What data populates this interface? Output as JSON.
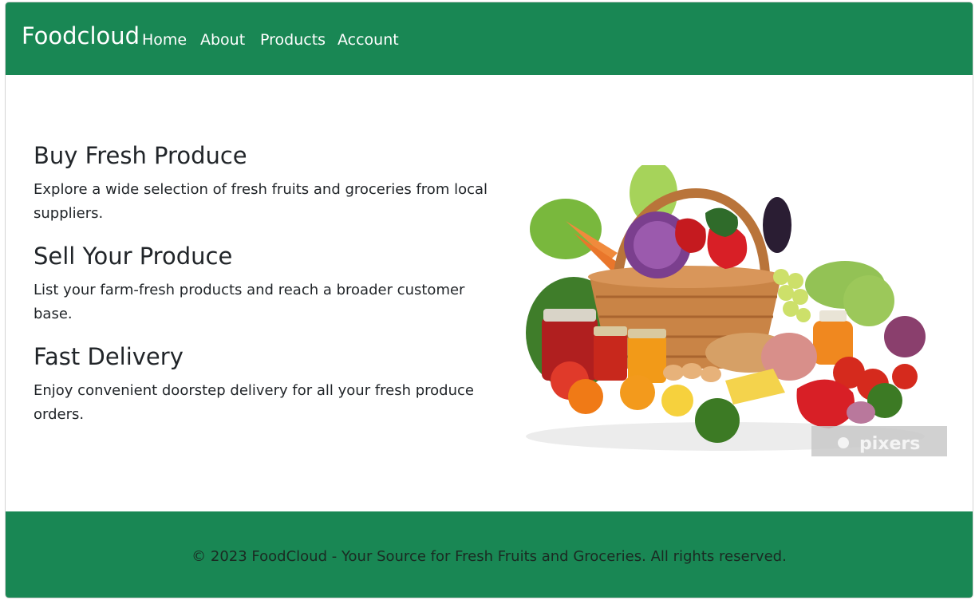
{
  "navbar": {
    "brand": "Foodcloud",
    "links": [
      "Home",
      "About",
      "Products",
      "Account"
    ]
  },
  "features": [
    {
      "title": "Buy Fresh Produce",
      "text": "Explore a wide selection of fresh fruits and groceries from local suppliers."
    },
    {
      "title": "Sell Your Produce",
      "text": "List your farm-fresh products and reach a broader customer base."
    },
    {
      "title": "Fast Delivery",
      "text": "Enjoy convenient doorstep delivery for all your fresh produce orders."
    }
  ],
  "hero_image": {
    "watermark": "pixers"
  },
  "footer": {
    "text": "© 2023 FoodCloud - Your Source for Fresh Fruits and Groceries. All rights reserved."
  },
  "colors": {
    "primary_green": "#198754"
  }
}
